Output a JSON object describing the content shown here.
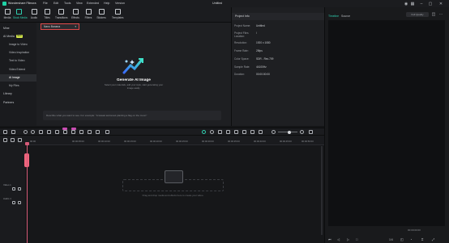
{
  "app": {
    "name": "Wondershare Filmora",
    "window_title": "Untitled",
    "menu": [
      "File",
      "Edit",
      "Tools",
      "View",
      "Extended",
      "Help",
      "Version"
    ]
  },
  "toolbar": {
    "items": [
      {
        "label": "Media",
        "icon": "media-icon"
      },
      {
        "label": "Stock Media",
        "icon": "stock-media-icon",
        "active": true
      },
      {
        "label": "Audio",
        "icon": "audio-icon"
      },
      {
        "label": "Titles",
        "icon": "titles-icon"
      },
      {
        "label": "Transitions",
        "icon": "transitions-icon"
      },
      {
        "label": "Effects",
        "icon": "effects-icon"
      },
      {
        "label": "Filters",
        "icon": "filters-icon"
      },
      {
        "label": "Stickers",
        "icon": "stickers-icon"
      },
      {
        "label": "Templates",
        "icon": "templates-icon"
      }
    ]
  },
  "sidebar": {
    "mine": "Mine",
    "ai_media": "AI Media",
    "ai_media_badge": "NEW",
    "items": [
      "Image to Video",
      "Video Inspiration",
      "Text to Video",
      "Video Extend",
      "AI Image",
      "My Files"
    ],
    "active_index": 4,
    "library": "Library",
    "partners": "Partners"
  },
  "media": {
    "model_select": "Nano Banana",
    "title": "Generate AI Image",
    "subtitle": "Select your materials, add your style, start generating your image easily.",
    "prompt_placeholder": "Describe what you want to see. For example: \"A kawaii astronaut planting a flag on the moon\""
  },
  "project_info": {
    "header": "Project Info",
    "rows": [
      {
        "label": "Project Name:",
        "value": "Untitled"
      },
      {
        "label": "Project Files Location:",
        "value": "/"
      },
      {
        "label": "Resolution:",
        "value": "1920 x 1080"
      },
      {
        "label": "Frame Rate:",
        "value": "25fps"
      },
      {
        "label": "Color Space:",
        "value": "SDR - Rec.709"
      },
      {
        "label": "Sample Rate:",
        "value": "44100Hz"
      },
      {
        "label": "Duration:",
        "value": "00:00:00:00"
      }
    ]
  },
  "preview": {
    "tabs": [
      "Timeline",
      "Source"
    ],
    "active_tab": 0,
    "quality": "Full Quality",
    "timecode": "00:00:00:00",
    "ratio": "1/4"
  },
  "timeline": {
    "ruler": [
      "00:00",
      "00:00:05:00",
      "00:00:10:00",
      "00:00:15:00",
      "00:00:20:00",
      "00:00:25:00",
      "00:00:30:00",
      "00:00:35:00",
      "00:00:40:00",
      "00:00:45:00",
      "00:00:50:00"
    ],
    "drop_text": "Drag and drop media and effects here to create your video.",
    "tracks": [
      "Video 1",
      "Audio 1"
    ]
  },
  "colors": {
    "accent": "#2fd0b0",
    "playhead": "#d65a78",
    "highlight": "#e04848"
  }
}
